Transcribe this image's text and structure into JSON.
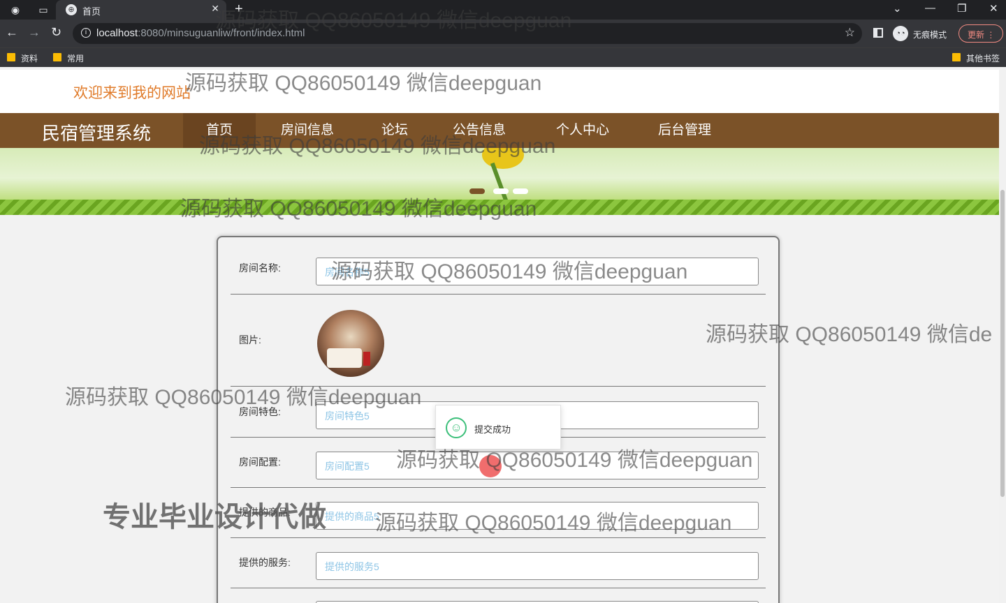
{
  "browser": {
    "tab_title": "首页",
    "url_host": "localhost",
    "url_rest": ":8080/minsuguanliw/front/index.html",
    "incognito_label": "无痕模式",
    "update_label": "更新",
    "bookmarks": [
      "资料",
      "常用"
    ],
    "other_bookmarks": "其他书签"
  },
  "site": {
    "welcome": "欢迎来到我的网站",
    "brand": "民宿管理系统",
    "nav": [
      "首页",
      "房间信息",
      "论坛",
      "公告信息",
      "个人中心",
      "后台管理"
    ],
    "active_nav_index": 0
  },
  "form": {
    "fields": [
      {
        "label": "房间名称:",
        "value": "房间名称5"
      },
      {
        "label": "图片:",
        "value": ""
      },
      {
        "label": "房间特色:",
        "value": "房间特色5"
      },
      {
        "label": "房间配置:",
        "value": "房间配置5"
      },
      {
        "label": "提供的商品:",
        "value": "提供的商品5"
      },
      {
        "label": "提供的服务:",
        "value": "提供的服务5"
      }
    ]
  },
  "toast": {
    "message": "提交成功"
  },
  "watermark": {
    "text": "源码获取 QQ86050149 微信deepguan",
    "text_cut": "源码获取 QQ86050149 微信de",
    "promo": "专业毕业设计代做"
  },
  "colors": {
    "nav_bg": "#7b5228",
    "welcome": "#e07b2a",
    "toast_success": "#3cbf7a",
    "placeholder": "#8ec5e6"
  }
}
